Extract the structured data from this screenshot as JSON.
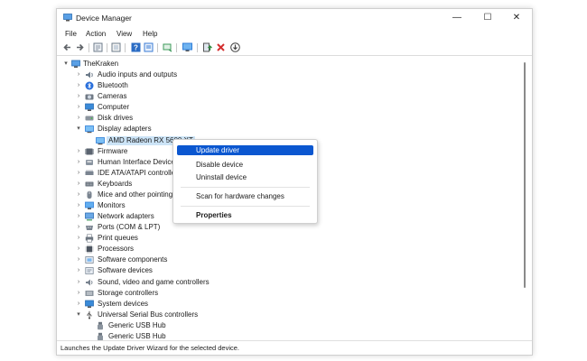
{
  "window": {
    "title": "Device Manager",
    "minimize": "—",
    "maximize": "☐",
    "close": "✕"
  },
  "menubar": [
    "File",
    "Action",
    "View",
    "Help"
  ],
  "toolbar": [
    {
      "name": "back-arrow-icon",
      "color": "#5f6368"
    },
    {
      "name": "forward-arrow-icon",
      "color": "#5f6368"
    },
    {
      "name": "properties-icon",
      "color": "#6d7b8a"
    },
    {
      "name": "show-hide-tree-icon",
      "color": "#6d7b8a"
    },
    {
      "name": "help-icon",
      "color": "#2b6cc4"
    },
    {
      "name": "properties-sheet-icon",
      "color": "#3a7bd5"
    },
    {
      "name": "scan-hardware-icon",
      "color": "#3c9a5a"
    },
    {
      "name": "monitor-icon",
      "color": "#2f7ed8"
    },
    {
      "name": "update-driver-icon",
      "color": "#2f8a3e"
    },
    {
      "name": "uninstall-icon",
      "color": "#d32f2f"
    },
    {
      "name": "download-icon",
      "color": "#444444"
    }
  ],
  "tree": {
    "root": "TheKraken",
    "items": [
      {
        "label": "Audio inputs and outputs",
        "icon": "speaker-icon",
        "expanded": false
      },
      {
        "label": "Bluetooth",
        "icon": "bluetooth-icon",
        "expanded": false
      },
      {
        "label": "Cameras",
        "icon": "camera-icon",
        "expanded": false
      },
      {
        "label": "Computer",
        "icon": "computer-icon",
        "expanded": false
      },
      {
        "label": "Disk drives",
        "icon": "disk-icon",
        "expanded": false
      },
      {
        "label": "Display adapters",
        "icon": "display-adapter-icon",
        "expanded": true
      },
      {
        "label": "AMD Radeon RX 5600 XT",
        "icon": "display-adapter-icon",
        "child": true,
        "selected": true
      },
      {
        "label": "Firmware",
        "icon": "firmware-icon",
        "expanded": false
      },
      {
        "label": "Human Interface Device",
        "icon": "hid-icon",
        "expanded": false
      },
      {
        "label": "IDE ATA/ATAPI controlle",
        "icon": "ide-controller-icon",
        "expanded": false
      },
      {
        "label": "Keyboards",
        "icon": "keyboard-icon",
        "expanded": false
      },
      {
        "label": "Mice and other pointing",
        "icon": "mouse-icon",
        "expanded": false
      },
      {
        "label": "Monitors",
        "icon": "monitor-icon",
        "expanded": false
      },
      {
        "label": "Network adapters",
        "icon": "network-adapter-icon",
        "expanded": false
      },
      {
        "label": "Ports (COM & LPT)",
        "icon": "port-icon",
        "expanded": false
      },
      {
        "label": "Print queues",
        "icon": "printer-icon",
        "expanded": false
      },
      {
        "label": "Processors",
        "icon": "processor-icon",
        "expanded": false
      },
      {
        "label": "Software components",
        "icon": "software-component-icon",
        "expanded": false
      },
      {
        "label": "Software devices",
        "icon": "software-device-icon",
        "expanded": false
      },
      {
        "label": "Sound, video and game controllers",
        "icon": "sound-icon",
        "expanded": false
      },
      {
        "label": "Storage controllers",
        "icon": "storage-controller-icon",
        "expanded": false
      },
      {
        "label": "System devices",
        "icon": "system-device-icon",
        "expanded": false
      },
      {
        "label": "Universal Serial Bus controllers",
        "icon": "usb-icon",
        "expanded": true
      },
      {
        "label": "Generic USB Hub",
        "icon": "usb-plug-icon",
        "child": true
      },
      {
        "label": "Generic USB Hub",
        "icon": "usb-plug-icon",
        "child": true
      }
    ]
  },
  "context_menu": {
    "items": [
      "Update driver",
      "Disable device",
      "Uninstall device",
      "Scan for hardware changes",
      "Properties"
    ],
    "highlighted": "Update driver"
  },
  "status": "Launches the Update Driver Wizard for the selected device.",
  "colors": {
    "highlight": "#0b57d0",
    "selection": "#cce4f7",
    "icon_blue": "#3a8ad8"
  }
}
